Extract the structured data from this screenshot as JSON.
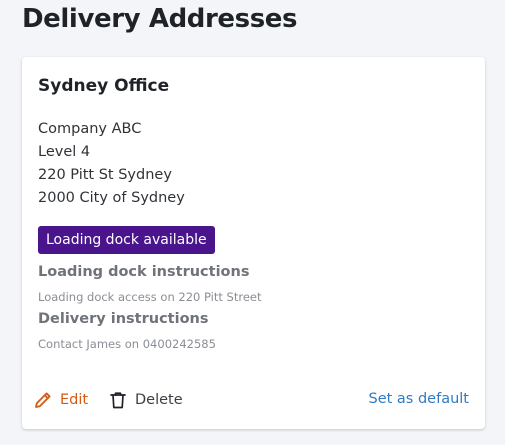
{
  "page": {
    "title": "Delivery Addresses"
  },
  "address_card": {
    "name": "Sydney Office",
    "lines": [
      "Company ABC",
      "Level 4",
      "220 Pitt St Sydney",
      "2000 City of Sydney"
    ],
    "badge": "Loading dock available",
    "loading_dock": {
      "heading": "Loading dock instructions",
      "text": "Loading dock access on 220 Pitt Street"
    },
    "delivery": {
      "heading": "Delivery instructions",
      "text": "Contact James on 0400242585"
    },
    "actions": {
      "edit_label": "Edit",
      "edit_icon": "pencil-icon",
      "delete_label": "Delete",
      "delete_icon": "trash-icon",
      "default_label": "Set as default"
    }
  },
  "colors": {
    "badge_background": "#4a148c",
    "edit_accent": "#d25a14",
    "link": "#2f7bc4"
  }
}
